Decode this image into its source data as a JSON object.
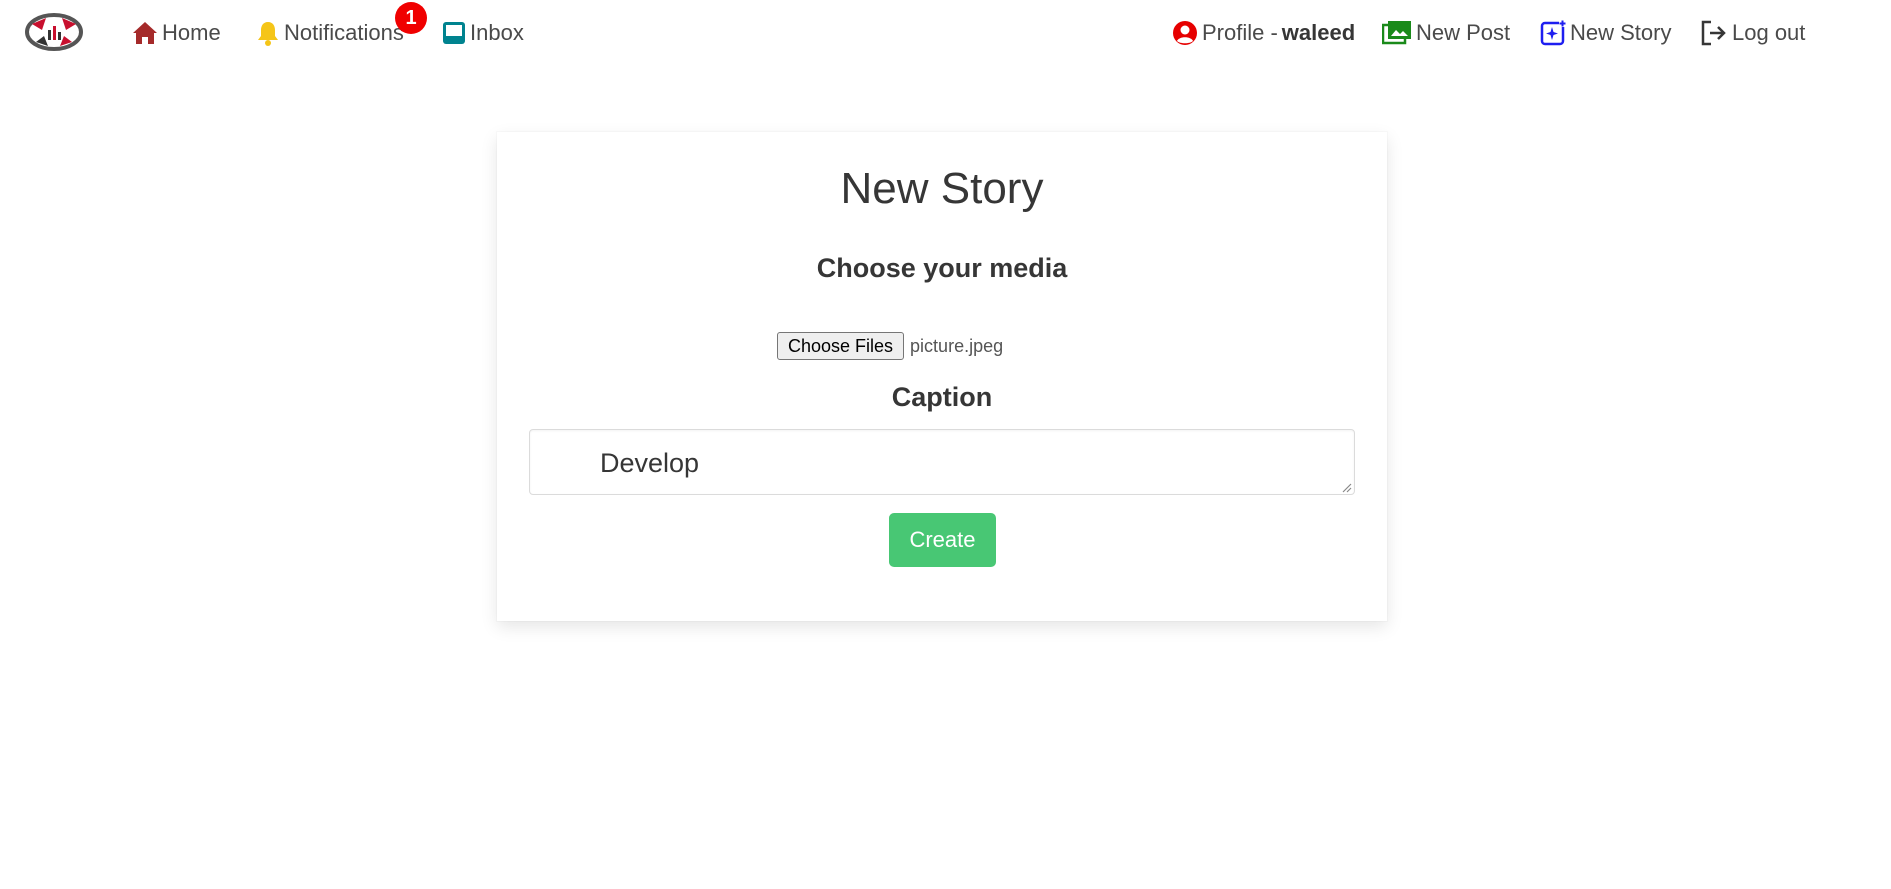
{
  "nav": {
    "home": {
      "label": "Home",
      "icon": "home-icon",
      "color": "#a52a2a"
    },
    "notifications": {
      "label": "Notifications",
      "icon": "bell-icon",
      "color": "#f5c518",
      "badge": "1"
    },
    "inbox": {
      "label": "Inbox",
      "icon": "inbox-icon",
      "color": "#00838f"
    },
    "profile": {
      "label": "Profile -",
      "username": "waleed",
      "icon": "user-circle-icon",
      "color": "#e60000"
    },
    "new_post": {
      "label": "New Post",
      "icon": "images-icon",
      "color": "#1a8a1a"
    },
    "new_story": {
      "label": "New Story",
      "icon": "story-plus-icon",
      "color": "#1e1ef0"
    },
    "logout": {
      "label": "Log out",
      "icon": "sign-out-icon",
      "color": "#363636"
    }
  },
  "form": {
    "title": "New Story",
    "media_label": "Choose your media",
    "choose_button": "Choose Files",
    "file_name": "picture.jpeg",
    "caption_label": "Caption",
    "caption_value": "Develop",
    "submit_label": "Create",
    "submit_color": "#48c774"
  }
}
